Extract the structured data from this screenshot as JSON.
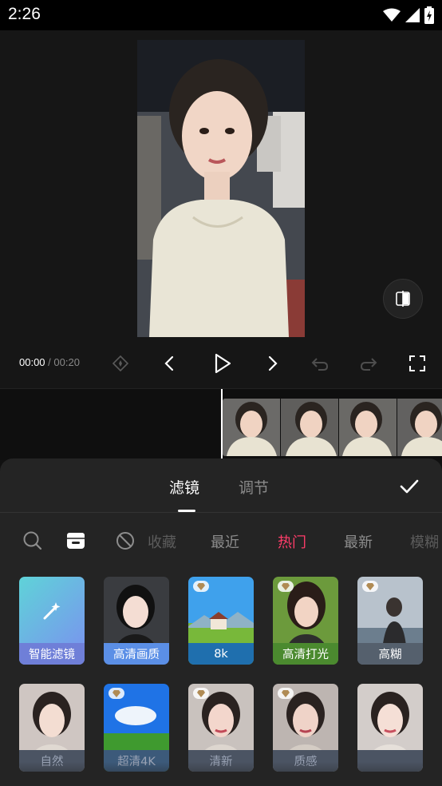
{
  "status": {
    "time": "2:26"
  },
  "player": {
    "current_time": "00:00",
    "separator": "/",
    "total_time": "00:20"
  },
  "panel": {
    "tabs": [
      "滤镜",
      "调节"
    ],
    "categories": [
      "收藏",
      "最近",
      "热门",
      "最新",
      "模糊"
    ],
    "active_category": "热门",
    "filters": [
      {
        "label": "智能滤镜",
        "icon": "ai-magic-wand-icon",
        "premium": false
      },
      {
        "label": "高清画质",
        "premium": false
      },
      {
        "label": "8k",
        "premium": true
      },
      {
        "label": "高清打光",
        "premium": true
      },
      {
        "label": "高糊",
        "premium": true
      },
      {
        "label": "自然",
        "premium": false
      },
      {
        "label": "超清4K",
        "premium": true
      },
      {
        "label": "清新",
        "premium": true
      },
      {
        "label": "质感",
        "premium": true
      },
      {
        "label": "",
        "premium": false
      }
    ]
  },
  "colors": {
    "accent": "#ff3d6a",
    "panel_bg": "#242424",
    "editor_bg": "#161616"
  }
}
